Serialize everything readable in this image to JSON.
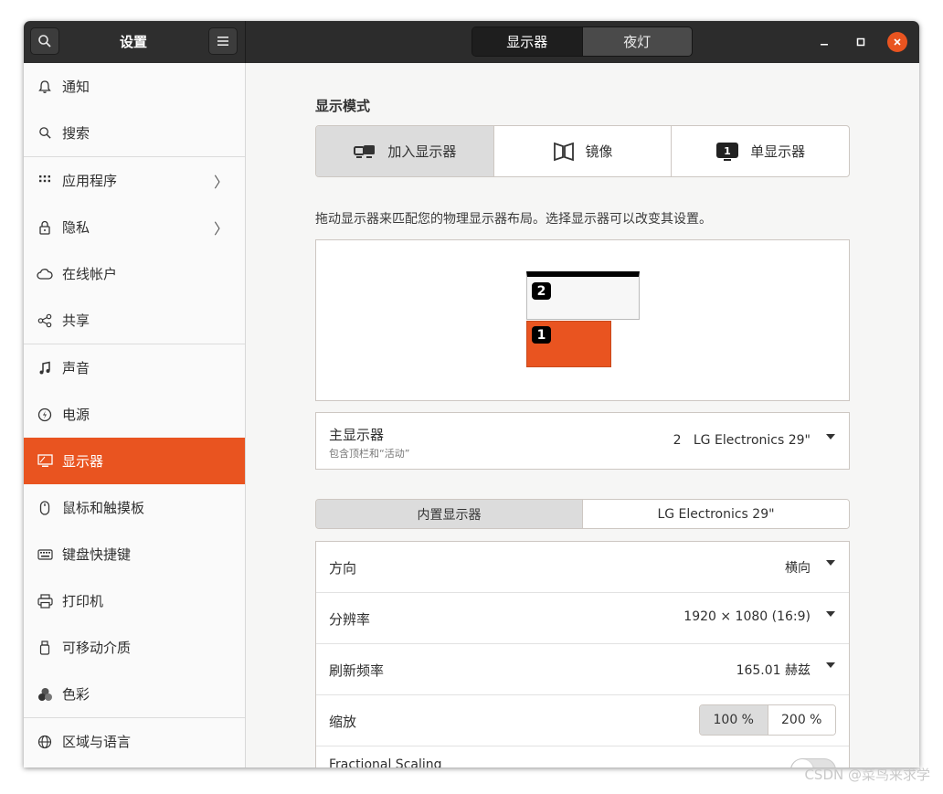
{
  "header": {
    "title": "设置",
    "tabs": [
      {
        "label": "显示器",
        "selected": true
      },
      {
        "label": "夜灯",
        "selected": false
      }
    ],
    "accent": "#e95420"
  },
  "sidebar": {
    "items": [
      {
        "label": "通知",
        "icon": "bell-icon"
      },
      {
        "label": "搜索",
        "icon": "search-icon"
      },
      {
        "label": "应用程序",
        "icon": "apps-grid-icon",
        "chevron": "〉"
      },
      {
        "label": "隐私",
        "icon": "lock-icon",
        "chevron": "〉"
      },
      {
        "label": "在线帐户",
        "icon": "cloud-icon"
      },
      {
        "label": "共享",
        "icon": "share-icon"
      },
      {
        "label": "声音",
        "icon": "music-note-icon"
      },
      {
        "label": "电源",
        "icon": "power-icon"
      },
      {
        "label": "显示器",
        "icon": "display-icon",
        "active": true
      },
      {
        "label": "鼠标和触摸板",
        "icon": "mouse-icon"
      },
      {
        "label": "键盘快捷键",
        "icon": "keyboard-icon"
      },
      {
        "label": "打印机",
        "icon": "printer-icon"
      },
      {
        "label": "可移动介质",
        "icon": "usb-drive-icon"
      },
      {
        "label": "色彩",
        "icon": "color-icon"
      },
      {
        "label": "区域与语言",
        "icon": "globe-icon"
      }
    ]
  },
  "display_mode": {
    "title": "显示模式",
    "options": [
      {
        "label": "加入显示器",
        "icon": "join-displays-icon",
        "selected": true
      },
      {
        "label": "镜像",
        "icon": "mirror-icon",
        "selected": false
      },
      {
        "label": "单显示器",
        "icon": "single-display-icon",
        "selected": false
      }
    ]
  },
  "arrangement": {
    "hint": "拖动显示器来匹配您的物理显示器布局。选择显示器可以改变其设置。",
    "monitors": [
      {
        "number": "2",
        "primary": true
      },
      {
        "number": "1",
        "selected": true
      }
    ]
  },
  "primary_display": {
    "title": "主显示器",
    "subtitle": "包含顶栏和“活动”",
    "value": "2   LG Electronics 29\""
  },
  "monitor_tabs": [
    {
      "label": "内置显示器",
      "selected": true
    },
    {
      "label": "LG Electronics 29\"",
      "selected": false
    }
  ],
  "settings": {
    "orientation": {
      "label": "方向",
      "value": "横向"
    },
    "resolution": {
      "label": "分辨率",
      "value": "1920 × 1080 (16:9)"
    },
    "refresh_rate": {
      "label": "刷新频率",
      "value": "165.01 赫兹"
    },
    "scale": {
      "label": "缩放",
      "options": [
        "100 %",
        "200 %"
      ],
      "selected": "100 %"
    },
    "fractional_scaling": {
      "label": "Fractional Scaling",
      "enabled": false
    }
  },
  "watermark": "CSDN @菜鸟来求学"
}
